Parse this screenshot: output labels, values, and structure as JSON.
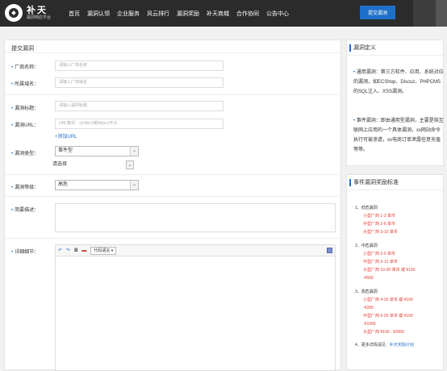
{
  "brand": {
    "name": "补天",
    "subtitle": "漏洞响应平台"
  },
  "nav": [
    "首页",
    "漏洞认领",
    "企业服务",
    "风云排行",
    "漏洞奖励",
    "补天商城",
    "合作协同",
    "公告中心"
  ],
  "header_button": "提交漏洞",
  "form": {
    "title": "提交漏洞",
    "vendor": {
      "label": "厂商名称：",
      "placeholder": "请输入厂商名称"
    },
    "domain": {
      "label": "所属域名：",
      "placeholder": "请输入厂商域名"
    },
    "vuln_title": {
      "label": "漏洞标题：",
      "placeholder": "请输入漏洞标题"
    },
    "vuln_url": {
      "label": "漏洞URL：",
      "placeholder": "URL格式：以http://或https://开头",
      "add_link": "+添加URL"
    },
    "vuln_type": {
      "label": "漏洞类型：",
      "value": "事件型",
      "second_value": "请选择"
    },
    "vuln_level": {
      "label": "漏洞等级：",
      "value": "高危"
    },
    "brief": {
      "label": "简要描述："
    },
    "detail": {
      "label": "详细细节：",
      "toolbar": {
        "undo": "↶",
        "redo": "↷",
        "bold": "B",
        "image": "▬",
        "code_select": "代码语言"
      }
    }
  },
  "definition": {
    "title": "漏洞定义",
    "items": [
      "通用漏洞：第三方软件、应用、系统对应的漏洞，如ECShop、Discuz、PHPCMS的SQL注入、XSS漏洞。",
      "事件漏洞：即由通用型漏洞，主要是指互联网上应用的一个具体漏洞，xx网站命令执行可被渗透，xx电商订单泄露任意充值等等。"
    ]
  },
  "reward": {
    "title": "事件漏洞奖励标准",
    "groups": [
      {
        "head": "1、低危漏洞",
        "items": [
          "小型厂商 1-3 单币",
          "中型厂商 2-6 单币",
          "大型厂商 3-10 单币"
        ]
      },
      {
        "head": "2、中危漏洞",
        "items": [
          "小型厂商 2-5 单币",
          "中型厂商 3-12 单币",
          "大型厂商 10-30 单币 或 ¥100",
          "-¥500"
        ]
      },
      {
        "head": "3、高危漏洞",
        "items": [
          "小型厂商 4-20 单币 或 ¥100",
          "-¥200",
          "中型厂商 6-25 单币 或 ¥100",
          "-¥1000",
          "大型厂商 ¥100 - ¥2000"
        ]
      }
    ],
    "tip": "4、更多详情请见：",
    "tip_link": "补天奖励计划"
  }
}
